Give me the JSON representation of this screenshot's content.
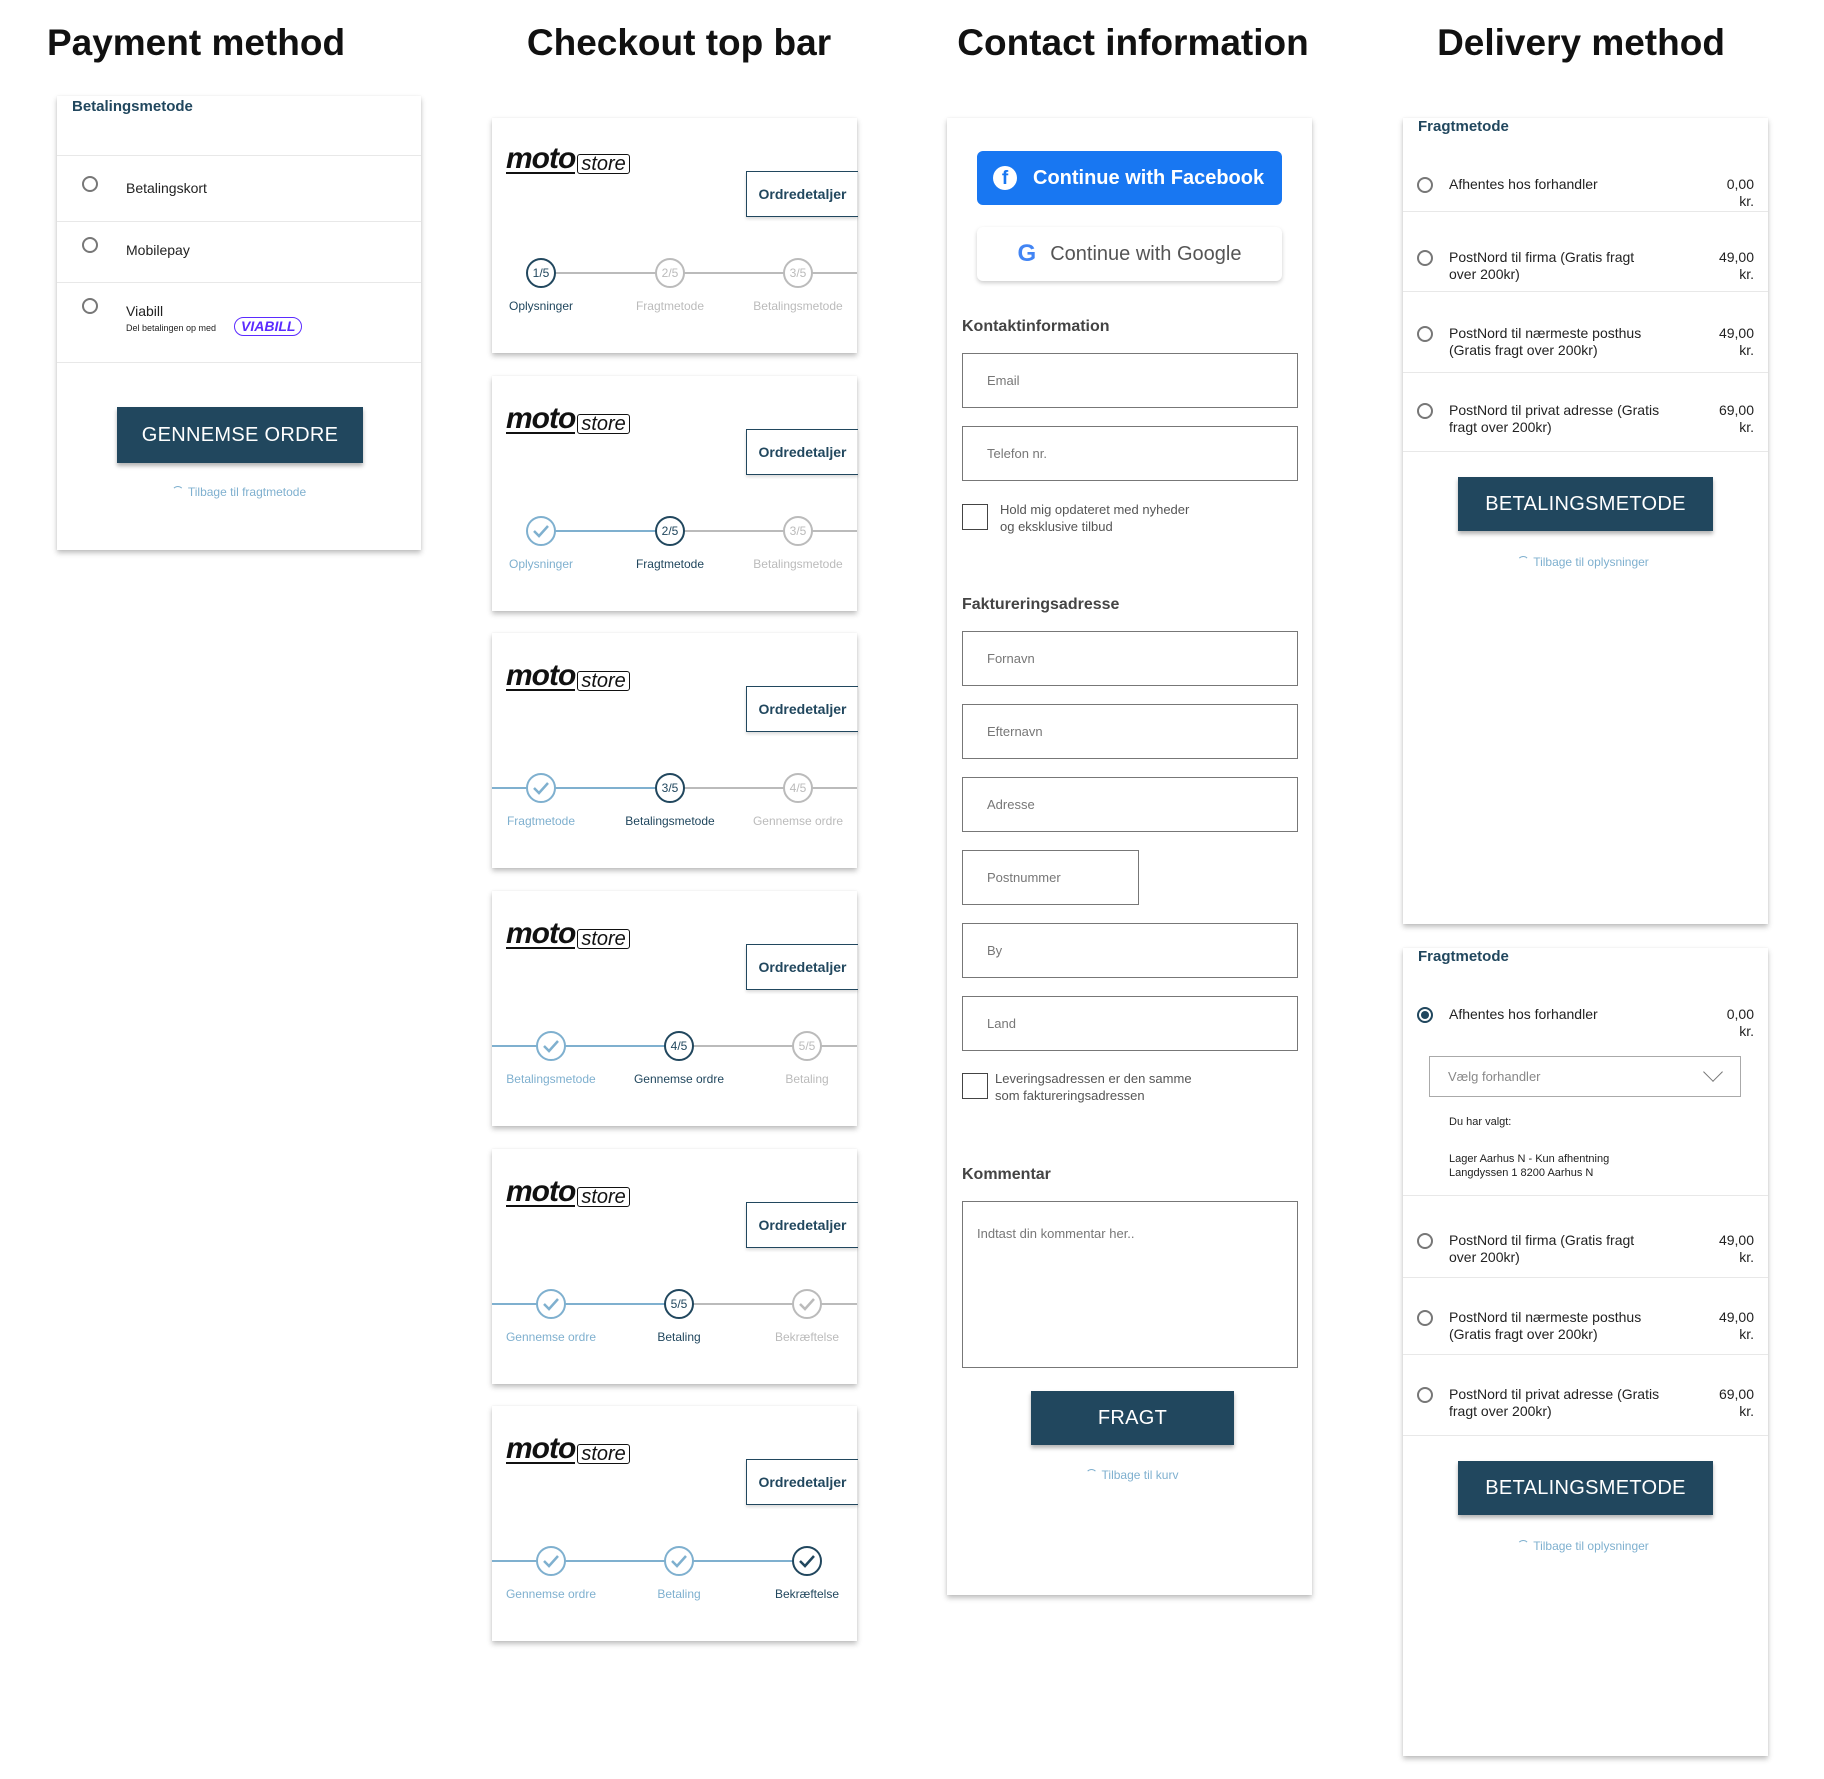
{
  "titles": {
    "payment": "Payment method",
    "topbar": "Checkout top bar",
    "contact": "Contact information",
    "delivery": "Delivery method"
  },
  "colors": {
    "primary": "#21475e",
    "accent_light": "#7fb0cf",
    "facebook": "#1877f2",
    "viabill": "#5b2bff",
    "inactive": "#bbbbbb"
  },
  "payment": {
    "header": "Betalingsmetode",
    "options": [
      {
        "label": "Betalingskort"
      },
      {
        "label": "Mobilepay"
      },
      {
        "label": "Viabill",
        "sublabel": "Del betalingen op med",
        "badge": "VIABILL"
      }
    ],
    "button": "GENNEMSE ORDRE",
    "back": "Tilbage til fragtmetode"
  },
  "topbar": {
    "logo": {
      "main": "moto",
      "sub": "store"
    },
    "order_button": "Ordredetaljer",
    "cards": [
      {
        "steps": [
          {
            "num": "1/5",
            "label": "Oplysninger",
            "state": "current"
          },
          {
            "num": "2/5",
            "label": "Fragtmetode",
            "state": "todo"
          },
          {
            "num": "3/5",
            "label": "Betalingsmetode",
            "state": "todo"
          }
        ]
      },
      {
        "steps": [
          {
            "num": "",
            "label": "Oplysninger",
            "state": "done"
          },
          {
            "num": "2/5",
            "label": "Fragtmetode",
            "state": "current"
          },
          {
            "num": "3/5",
            "label": "Betalingsmetode",
            "state": "todo"
          }
        ]
      },
      {
        "steps": [
          {
            "num": "",
            "label": "Fragtmetode",
            "state": "done"
          },
          {
            "num": "3/5",
            "label": "Betalingsmetode",
            "state": "current"
          },
          {
            "num": "4/5",
            "label": "Gennemse ordre",
            "state": "todo"
          }
        ]
      },
      {
        "steps": [
          {
            "num": "",
            "label": "Betalingsmetode",
            "state": "done"
          },
          {
            "num": "4/5",
            "label": "Gennemse ordre",
            "state": "current"
          },
          {
            "num": "5/5",
            "label": "Betaling",
            "state": "todo"
          }
        ]
      },
      {
        "steps": [
          {
            "num": "",
            "label": "Gennemse ordre",
            "state": "done"
          },
          {
            "num": "5/5",
            "label": "Betaling",
            "state": "current"
          },
          {
            "num": "",
            "label": "Bekræftelse",
            "state": "todo-check"
          }
        ]
      },
      {
        "steps": [
          {
            "num": "",
            "label": "Gennemse ordre",
            "state": "done"
          },
          {
            "num": "",
            "label": "Betaling",
            "state": "done"
          },
          {
            "num": "",
            "label": "Bekræftelse",
            "state": "current-check"
          }
        ]
      }
    ]
  },
  "contact": {
    "facebook": "Continue with Facebook",
    "google": "Continue with Google",
    "contact_title": "Kontaktinformation",
    "email_ph": "Email",
    "phone_ph": "Telefon nr.",
    "newsletter": [
      "Hold mig opdateret med nyheder",
      "og eksklusive tilbud"
    ],
    "billing_title": "Faktureringsadresse",
    "firstname_ph": "Fornavn",
    "lastname_ph": "Efternavn",
    "address_ph": "Adresse",
    "zip_ph": "Postnummer",
    "city_ph": "By",
    "country_ph": "Land",
    "same_address": [
      "Leveringsadressen er den samme",
      "som faktureringsadressen"
    ],
    "comment_title": "Kommentar",
    "comment_ph": "Indtast din kommentar her..",
    "button": "FRAGT",
    "back": "Tilbage til kurv"
  },
  "delivery": {
    "header": "Fragtmetode",
    "options": [
      {
        "label": [
          "Afhentes hos forhandler",
          ""
        ],
        "price": "0,00",
        "unit": "kr."
      },
      {
        "label": [
          "PostNord til firma (Gratis fragt",
          "over 200kr)"
        ],
        "price": "49,00",
        "unit": "kr."
      },
      {
        "label": [
          "PostNord til nærmeste posthus",
          "(Gratis fragt over 200kr)"
        ],
        "price": "49,00",
        "unit": "kr."
      },
      {
        "label": [
          "PostNord til privat adresse (Gratis",
          "fragt over 200kr)"
        ],
        "price": "69,00",
        "unit": "kr."
      }
    ],
    "dealer_select_ph": "Vælg forhandler",
    "chosen_label": "Du har valgt:",
    "chosen_lines": [
      "Lager Aarhus N - Kun afhentning",
      "Langdyssen 1 8200 Aarhus N"
    ],
    "button": "BETALINGSMETODE",
    "back": "Tilbage til oplysninger"
  }
}
